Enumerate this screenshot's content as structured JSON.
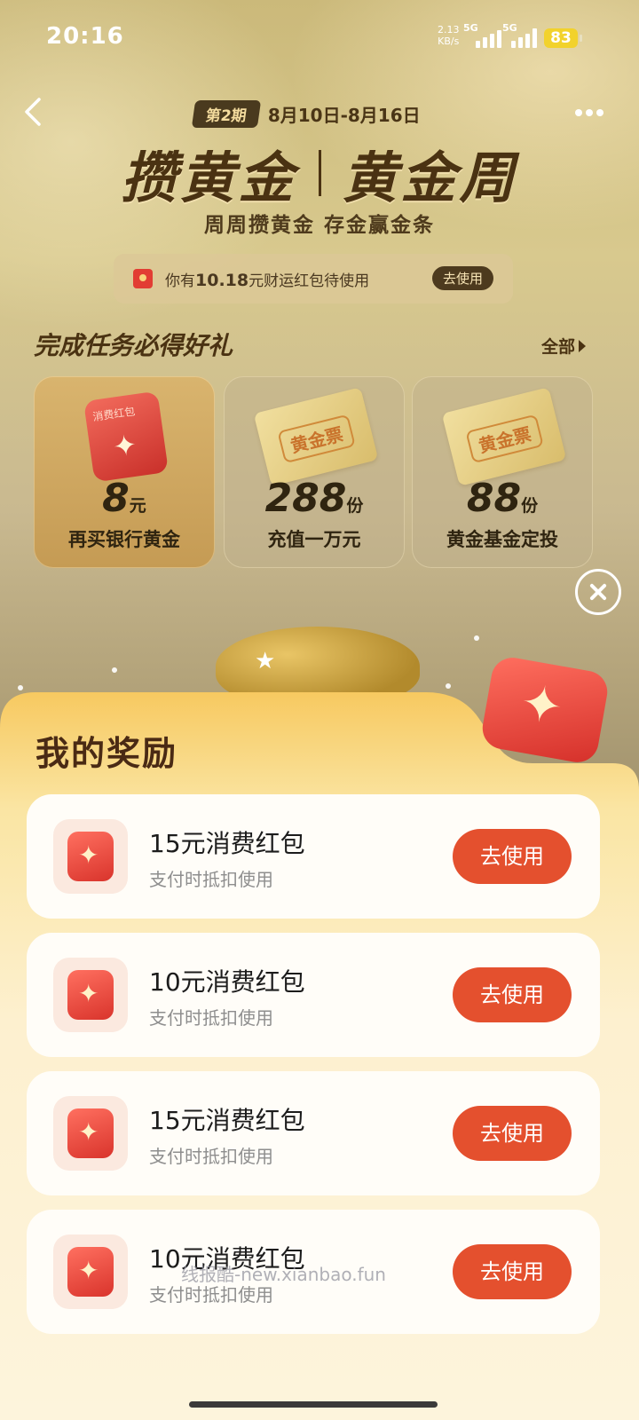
{
  "status_bar": {
    "time": "20:16",
    "net_speed_top": "2.13",
    "net_speed_bottom": "KB/s",
    "sim1": "5G",
    "sim2": "5G",
    "battery": "83"
  },
  "header": {
    "period_badge": "第2期",
    "period_dates": "8月10日-8月16日",
    "title_left": "攒黄金",
    "title_right": "黄金周",
    "subtitle": "周周攒黄金 存金赢金条"
  },
  "notice": {
    "prefix": "你有",
    "amount": "10.18",
    "suffix": "元财运红包待使用",
    "button": "去使用"
  },
  "tasks": {
    "title": "完成任务必得好礼",
    "all_label": "全部",
    "items": [
      {
        "badge": "消费红包",
        "amount": "8",
        "unit": "元",
        "desc": "再买银行黄金"
      },
      {
        "badge": "黄金票",
        "amount": "288",
        "unit": "份",
        "desc": "充值一万元"
      },
      {
        "badge": "黄金票",
        "amount": "88",
        "unit": "份",
        "desc": "黄金基金定投"
      }
    ]
  },
  "rewards": {
    "title": "我的奖励",
    "items": [
      {
        "title": "15元消费红包",
        "subtitle": "支付时抵扣使用",
        "button": "去使用"
      },
      {
        "title": "10元消费红包",
        "subtitle": "支付时抵扣使用",
        "button": "去使用"
      },
      {
        "title": "15元消费红包",
        "subtitle": "支付时抵扣使用",
        "button": "去使用"
      },
      {
        "title": "10元消费红包",
        "subtitle": "支付时抵扣使用",
        "button": "去使用"
      }
    ]
  },
  "watermark": "线报酷-new.xianbao.fun",
  "colors": {
    "accent_button": "#e4502e",
    "title_brown": "#4a3212",
    "battery": "#f2d22c"
  }
}
